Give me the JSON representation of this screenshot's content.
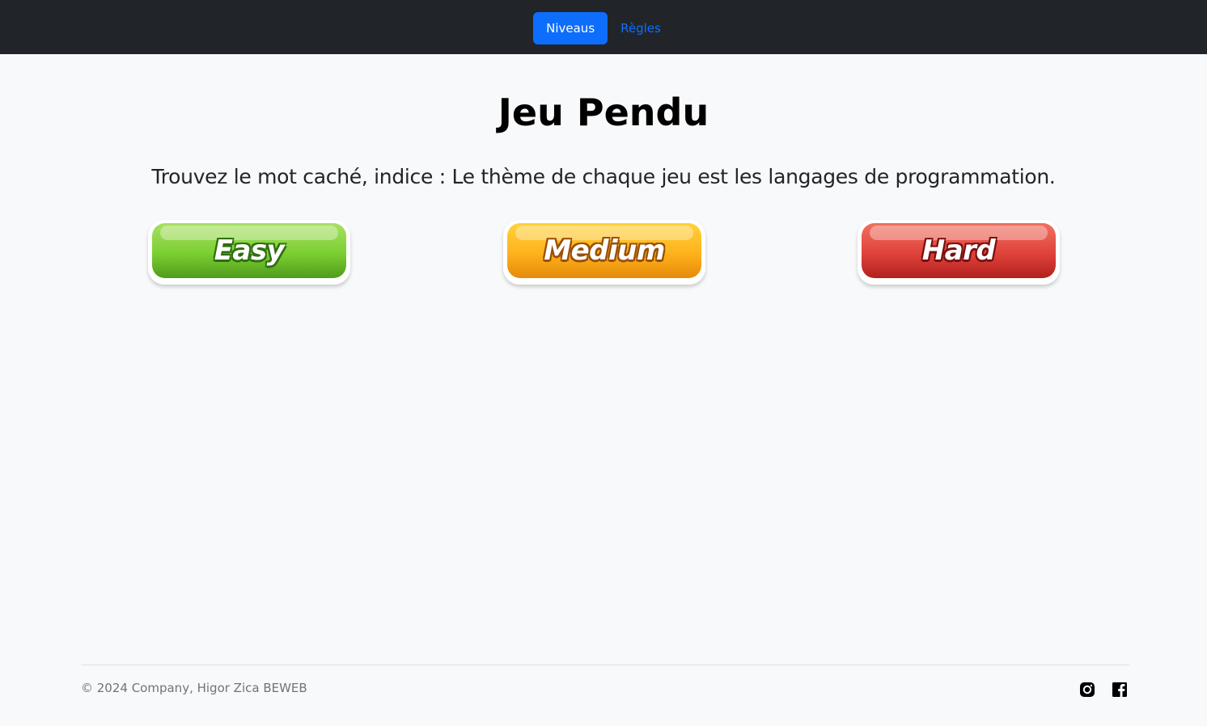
{
  "nav": {
    "items": [
      {
        "label": "Niveaus",
        "active": true
      },
      {
        "label": "Règles",
        "active": false
      }
    ]
  },
  "main": {
    "title": "Jeu Pendu",
    "subtitle": "Trouvez le mot caché, indice : Le thème de chaque jeu est les langages de programmation.",
    "levels": [
      {
        "label": "Easy",
        "color": "#7ccf32"
      },
      {
        "label": "Medium",
        "color": "#ffb21c"
      },
      {
        "label": "Hard",
        "color": "#e0433b"
      }
    ]
  },
  "footer": {
    "copyright": "© 2024 Company, Higor Zica BEWEB",
    "social_icons": [
      "instagram-icon",
      "facebook-icon"
    ]
  },
  "colors": {
    "navbar_bg": "#212529",
    "accent": "#0d6efd",
    "page_bg": "#f8f9fa"
  }
}
